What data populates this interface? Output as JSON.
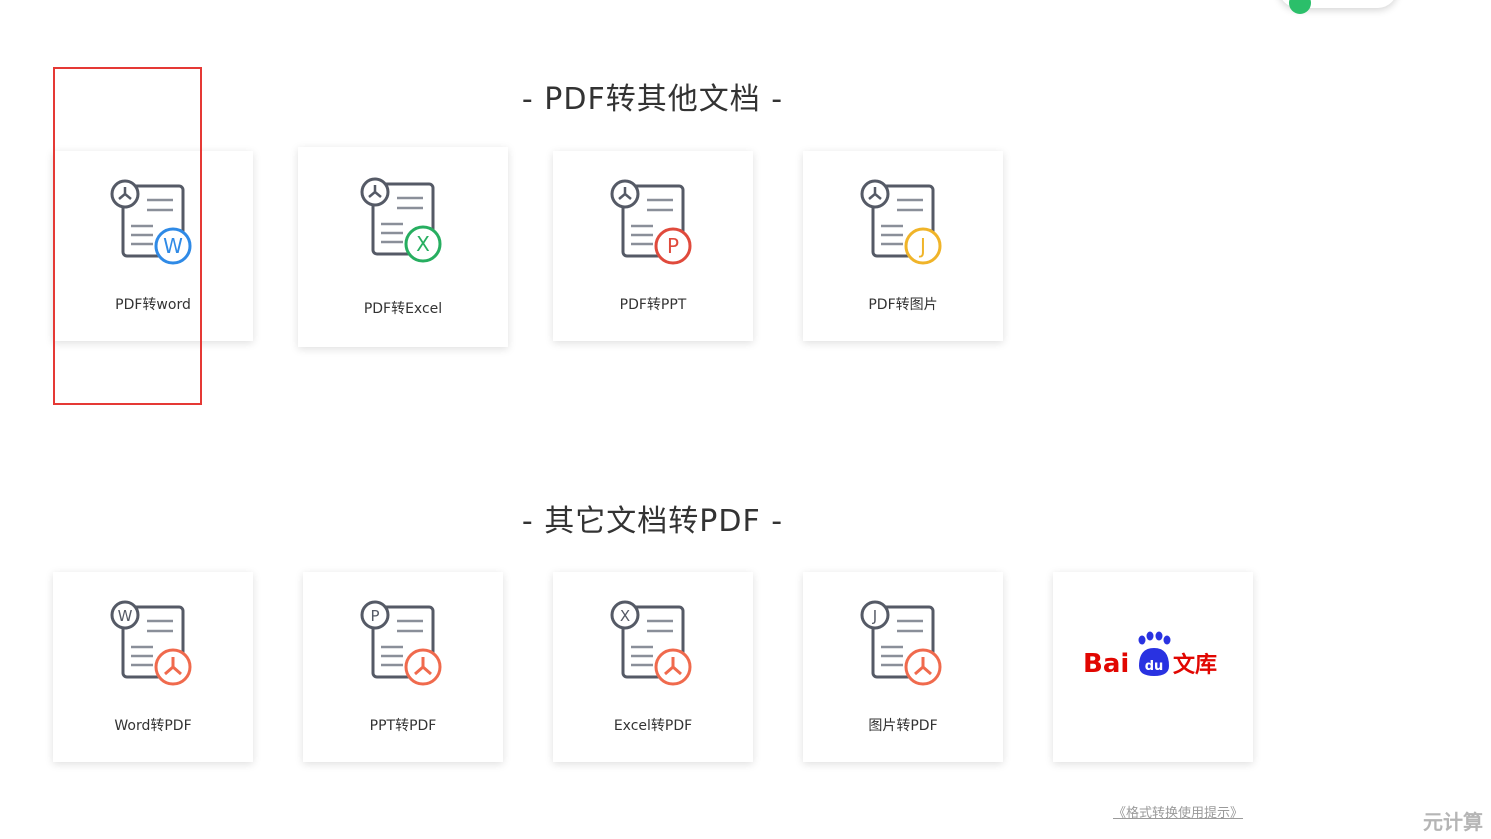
{
  "section_pdf_to_other": {
    "title": "- PDF转其他文档 -",
    "cards": [
      {
        "label": "PDF转word",
        "badge": "W",
        "badge_color": "#2f8ae6"
      },
      {
        "label": "PDF转Excel",
        "badge": "X",
        "badge_color": "#27ae60"
      },
      {
        "label": "PDF转PPT",
        "badge": "P",
        "badge_color": "#e04a3c"
      },
      {
        "label": "PDF转图片",
        "badge": "J",
        "badge_color": "#f0b429"
      }
    ]
  },
  "section_other_to_pdf": {
    "title": "- 其它文档转PDF -",
    "cards": [
      {
        "label": "Word转PDF",
        "corner": "W"
      },
      {
        "label": "PPT转PDF",
        "corner": "P"
      },
      {
        "label": "Excel转PDF",
        "corner": "X"
      },
      {
        "label": "图片转PDF",
        "corner": "J"
      }
    ],
    "baidu": {
      "text_bai": "Bai",
      "text_du": "du",
      "text_wenku": "文库"
    }
  },
  "footer": {
    "link_text": "《格式转换使用提示》"
  },
  "watermark": {
    "text": "元计算"
  },
  "colors": {
    "pdf_badge": "#f06a4d",
    "outline": "#555a66",
    "highlight": "#e53935",
    "baidu_red": "#e10601",
    "baidu_blue": "#2932e1"
  }
}
